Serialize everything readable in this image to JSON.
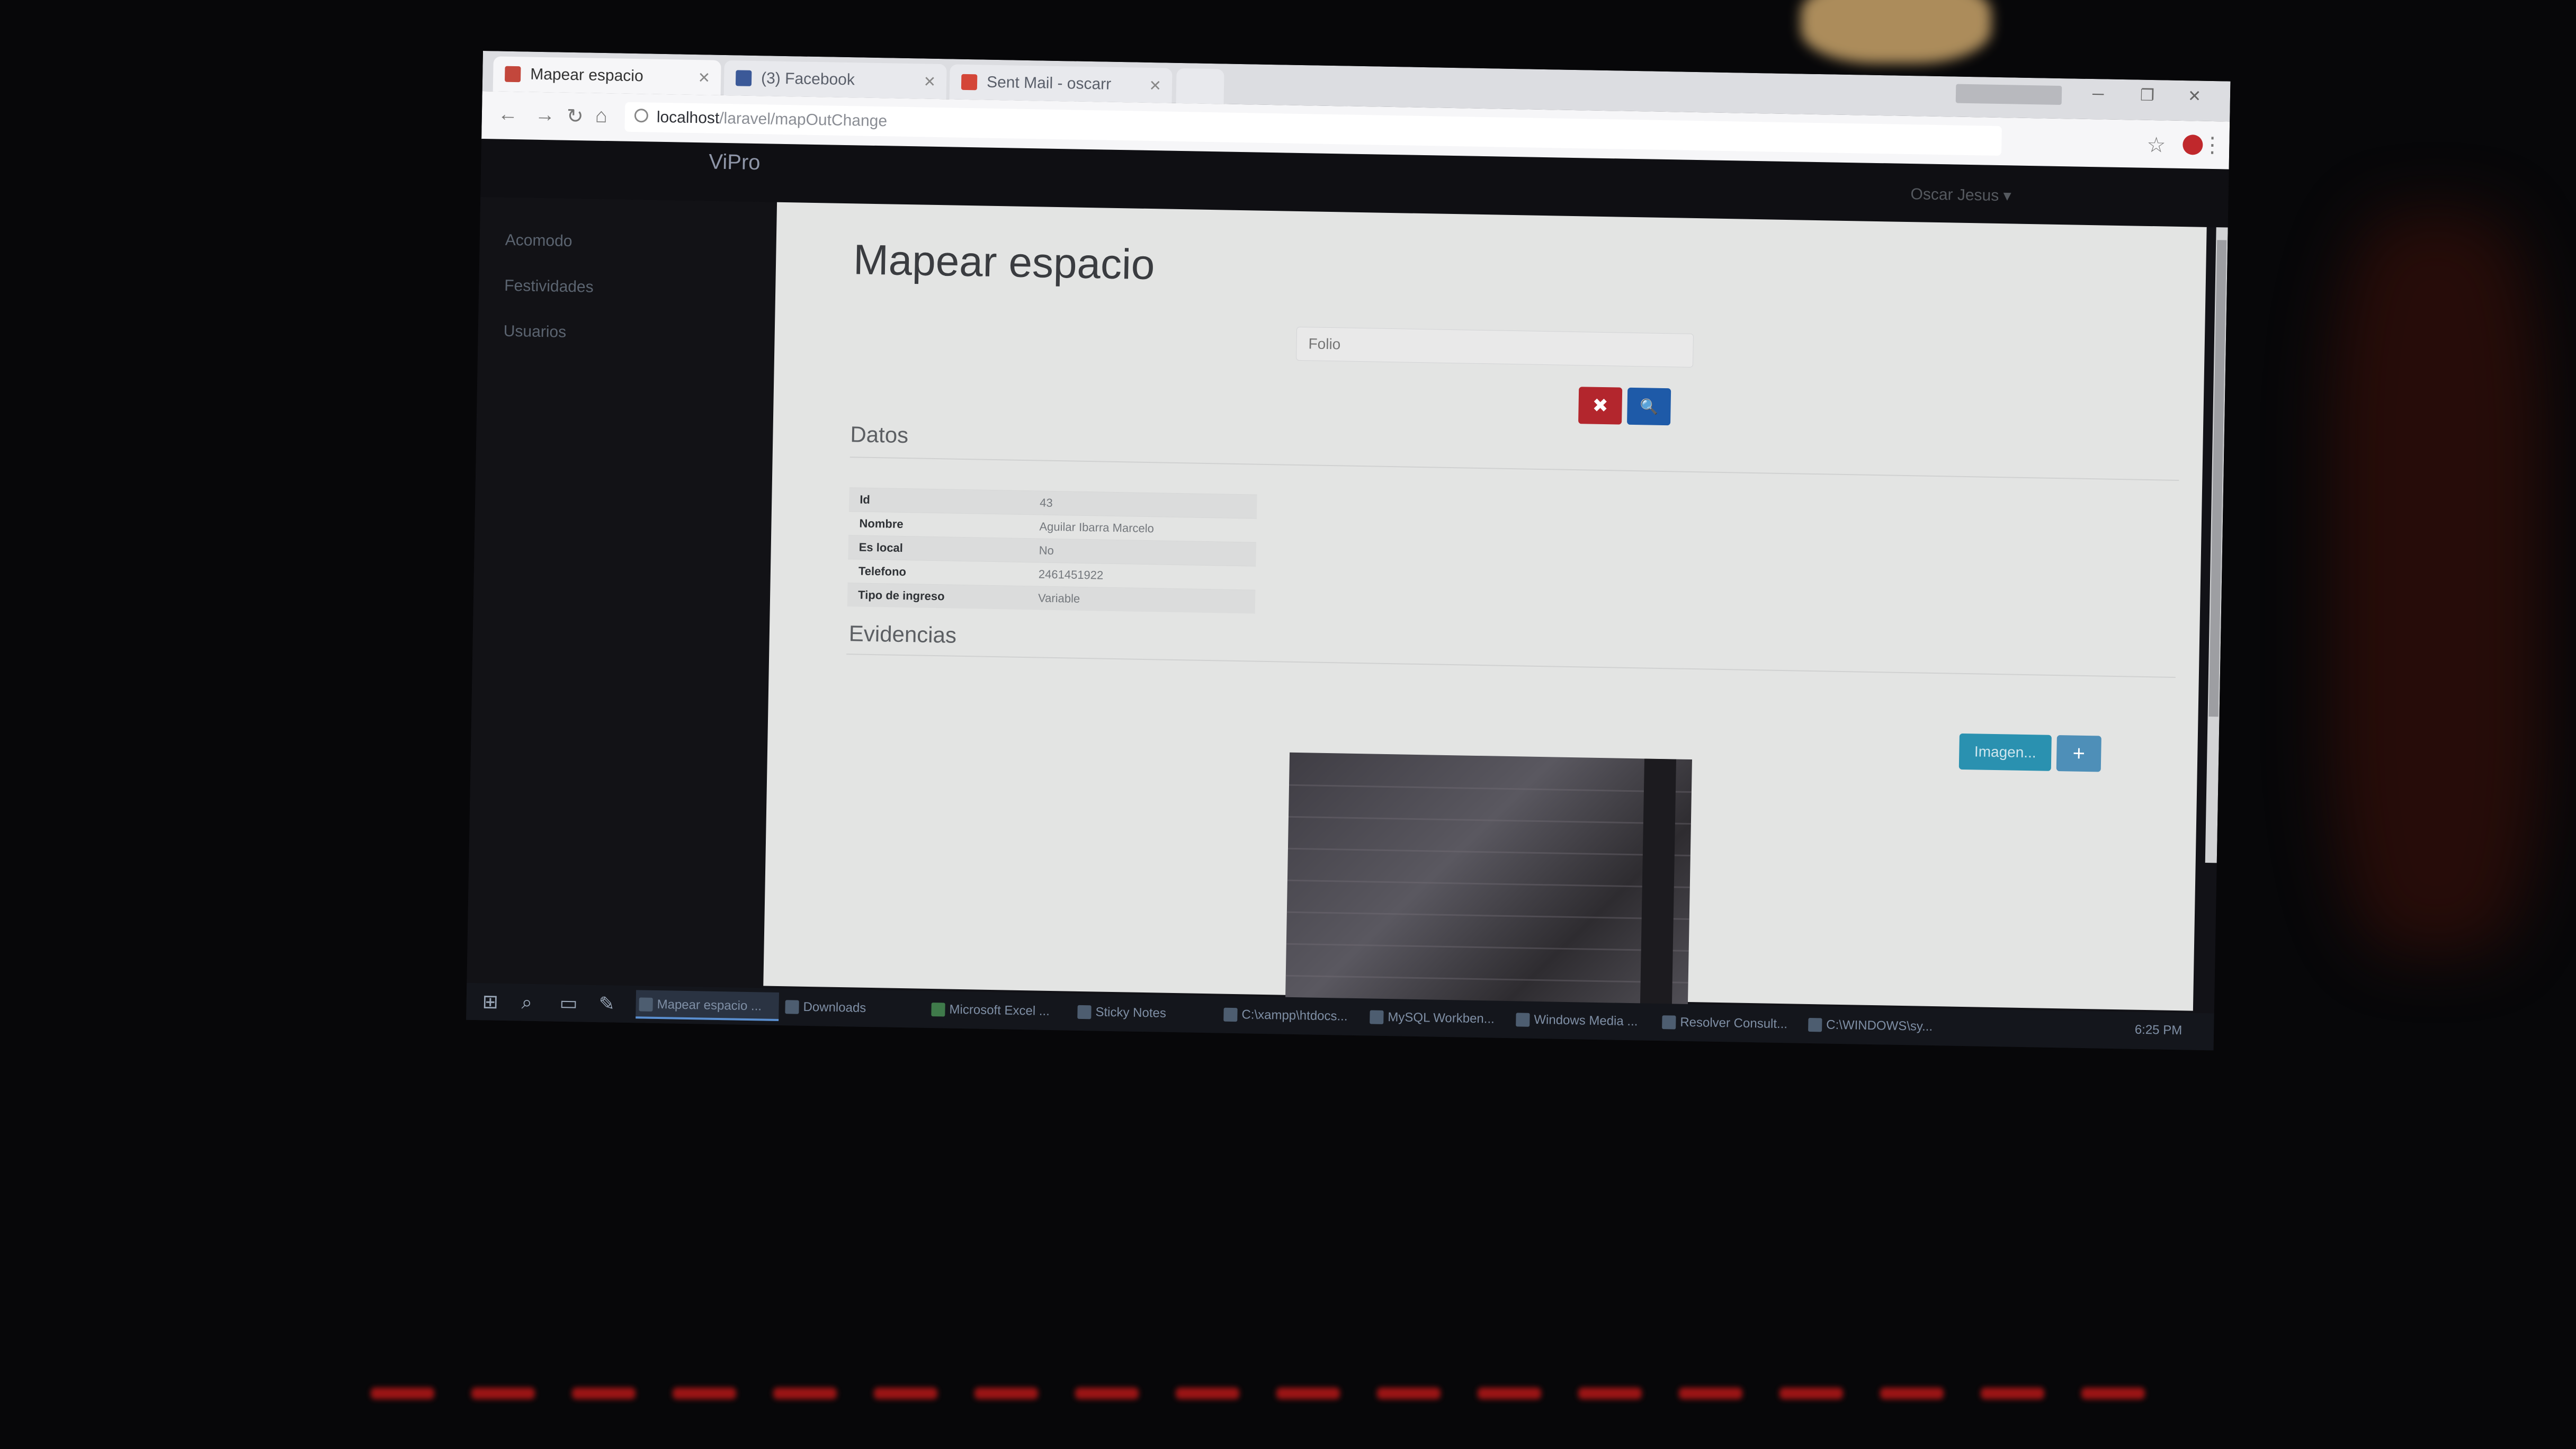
{
  "browser": {
    "tabs": [
      {
        "label": "Mapear espacio",
        "active": true,
        "icon": "vipro-favicon"
      },
      {
        "label": "(3) Facebook",
        "active": false,
        "icon": "facebook-icon"
      },
      {
        "label": "Sent Mail - oscarr",
        "active": false,
        "icon": "gmail-icon"
      }
    ],
    "url_host": "localhost",
    "url_path": "/laravel/mapOutChange"
  },
  "app": {
    "brand": "ViPro",
    "user_menu": "Oscar Jesus ▾",
    "sidebar": [
      {
        "label": "Acomodo"
      },
      {
        "label": "Festividades"
      },
      {
        "label": "Usuarios"
      }
    ]
  },
  "page": {
    "title": "Mapear espacio",
    "photo_placeholder": "Folio",
    "clear_icon": "✖",
    "search_icon": "🔍",
    "datos_heading": "Datos",
    "datos": [
      {
        "key": "Id",
        "value": "43"
      },
      {
        "key": "Nombre",
        "value": "Aguilar Ibarra Marcelo"
      },
      {
        "key": "Es local",
        "value": "No"
      },
      {
        "key": "Telefono",
        "value": "2461451922"
      },
      {
        "key": "Tipo de ingreso",
        "value": "Variable"
      }
    ],
    "evidencias_heading": "Evidencias",
    "imagen_button": "Imagen...",
    "plus_button": "+"
  },
  "taskbar": {
    "items": [
      {
        "label": "Mapear espacio ..."
      },
      {
        "label": "Downloads"
      },
      {
        "label": "Microsoft Excel ..."
      },
      {
        "label": "Sticky Notes"
      },
      {
        "label": "C:\\xampp\\htdocs..."
      },
      {
        "label": "MySQL Workben..."
      },
      {
        "label": "Windows Media ..."
      },
      {
        "label": "Resolver Consult..."
      },
      {
        "label": "C:\\WINDOWS\\sy..."
      }
    ],
    "clock": "6:25 PM"
  }
}
